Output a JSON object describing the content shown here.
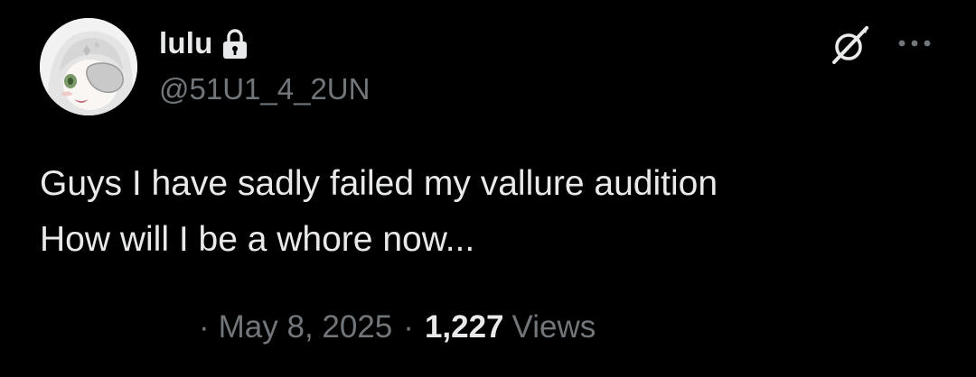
{
  "author": {
    "display_name": "lulu",
    "handle": "@51U1_4_2UN",
    "avatar_icon": "anime-avatar",
    "protected_icon": "lock-icon"
  },
  "actions": {
    "grok_icon": "grok-icon",
    "more_icon": "more-icon"
  },
  "post": {
    "lines": [
      "Guys I have sadly failed my vallure audition",
      "How will I be a whore now..."
    ]
  },
  "meta": {
    "separator": "·",
    "date": "May 8, 2025",
    "views_count": "1,227",
    "views_label": "Views"
  },
  "colors": {
    "background": "#000000",
    "primary_text": "#e7e9ea",
    "secondary_text": "#71767b"
  }
}
